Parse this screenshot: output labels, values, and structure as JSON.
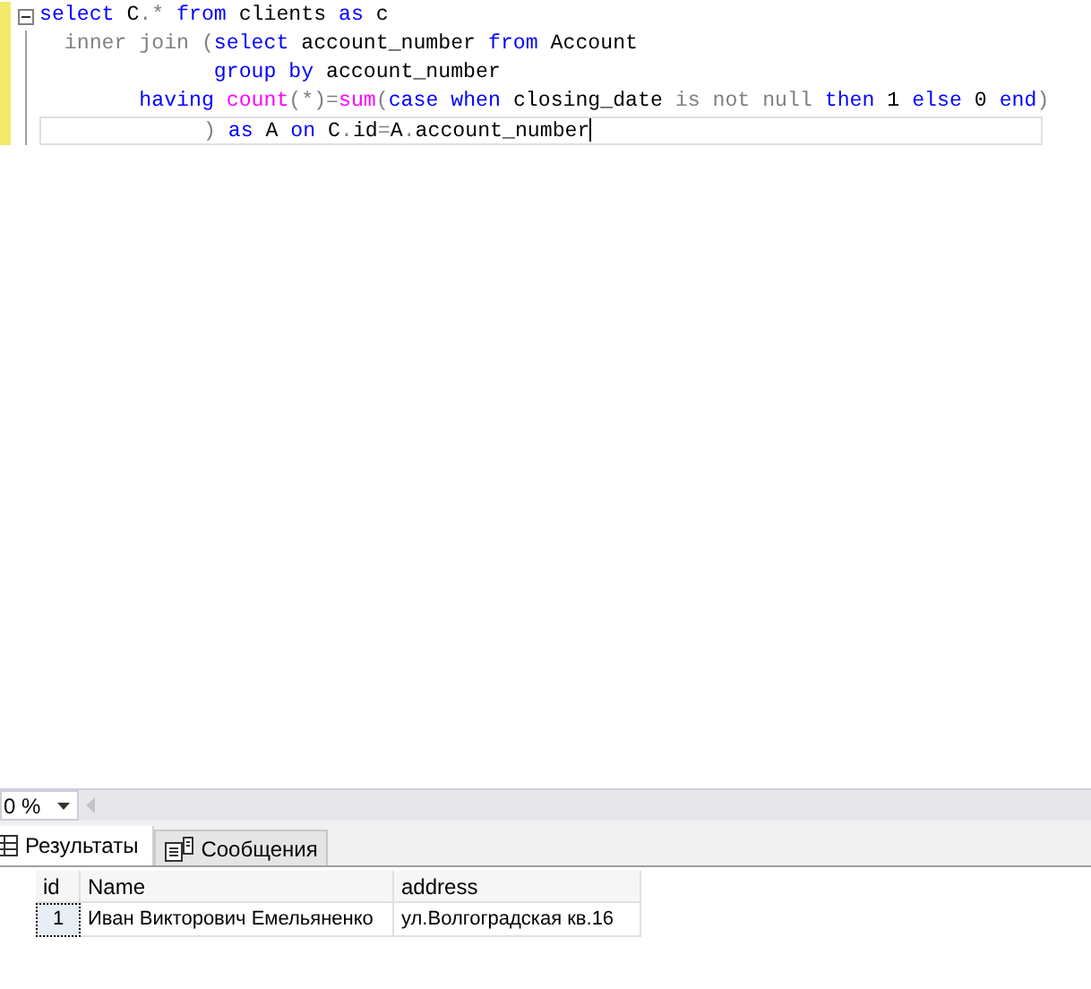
{
  "editor": {
    "lines": [
      {
        "tokens": [
          {
            "text": "select",
            "kind": "keyword"
          },
          {
            "text": " C",
            "kind": "plain"
          },
          {
            "text": ".*",
            "kind": "operator"
          },
          {
            "text": " from",
            "kind": "keyword"
          },
          {
            "text": " clients ",
            "kind": "plain"
          },
          {
            "text": "as",
            "kind": "keyword"
          },
          {
            "text": " c",
            "kind": "plain"
          }
        ]
      },
      {
        "tokens": [
          {
            "text": "  inner join (",
            "kind": "operator"
          },
          {
            "text": "select",
            "kind": "keyword"
          },
          {
            "text": " account_number ",
            "kind": "plain"
          },
          {
            "text": "from",
            "kind": "keyword"
          },
          {
            "text": " Account",
            "kind": "plain"
          }
        ]
      },
      {
        "tokens": [
          {
            "text": "              group by",
            "kind": "keyword"
          },
          {
            "text": " account_number",
            "kind": "plain"
          }
        ]
      },
      {
        "tokens": [
          {
            "text": "        having",
            "kind": "keyword"
          },
          {
            "text": " count",
            "kind": "function"
          },
          {
            "text": "(*)=",
            "kind": "operator"
          },
          {
            "text": "sum",
            "kind": "function"
          },
          {
            "text": "(",
            "kind": "operator"
          },
          {
            "text": "case",
            "kind": "keyword"
          },
          {
            "text": " when",
            "kind": "keyword"
          },
          {
            "text": " closing_date ",
            "kind": "plain"
          },
          {
            "text": "is not null",
            "kind": "operator"
          },
          {
            "text": " then",
            "kind": "keyword"
          },
          {
            "text": " 1 ",
            "kind": "plain"
          },
          {
            "text": "else",
            "kind": "keyword"
          },
          {
            "text": " 0 ",
            "kind": "plain"
          },
          {
            "text": "end",
            "kind": "keyword"
          },
          {
            "text": ")",
            "kind": "operator"
          }
        ]
      },
      {
        "tokens": [
          {
            "text": "             )",
            "kind": "operator"
          },
          {
            "text": " as",
            "kind": "keyword"
          },
          {
            "text": " A ",
            "kind": "plain"
          },
          {
            "text": "on",
            "kind": "keyword"
          },
          {
            "text": " C",
            "kind": "plain"
          },
          {
            "text": ".",
            "kind": "operator"
          },
          {
            "text": "id",
            "kind": "plain"
          },
          {
            "text": "=",
            "kind": "operator"
          },
          {
            "text": "A",
            "kind": "plain"
          },
          {
            "text": ".",
            "kind": "operator"
          },
          {
            "text": "account_number",
            "kind": "plain"
          }
        ]
      }
    ]
  },
  "zoom": {
    "value": "0 %"
  },
  "tabs": [
    {
      "label": "Результаты",
      "selected": true,
      "kind": "grid"
    },
    {
      "label": "Сообщения",
      "selected": false,
      "kind": "messages"
    }
  ],
  "table": {
    "columns": [
      "id",
      "Name",
      "address"
    ],
    "rows": [
      [
        "1",
        "Иван Викторович Емельяненко",
        "ул.Волгоградская кв.16"
      ]
    ]
  }
}
